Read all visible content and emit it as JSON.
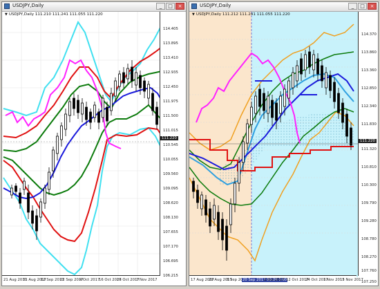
{
  "windows": [
    {
      "title": "USDJPY,Daily",
      "info_symbol": "USDJPY,Daily",
      "info_prices": "111.210 111.241 111.055 111.220",
      "controls": {
        "minimize": "_",
        "maximize": "□",
        "close": "×"
      },
      "y_ticks": [
        "114.405",
        "113.895",
        "113.410",
        "112.935",
        "112.450",
        "111.975",
        "111.500",
        "111.015",
        "110.545",
        "110.055",
        "109.560",
        "109.095",
        "108.620",
        "108.130",
        "107.655",
        "107.170",
        "106.695",
        "106.215"
      ],
      "price_tag": "111.220",
      "x_labels": [
        "21 Aug 2017",
        "31 Aug 2017",
        "12 Sep 2017",
        "22 Sep 2017",
        "4 Oct 2017",
        "16 Oct 2017",
        "26 Oct 2017",
        "7 Nov 2017",
        "17 Nov 2017"
      ],
      "colors": {
        "bollinger_outer": "#40e0f0",
        "bollinger_mid": "#e01010",
        "bollinger_inner": "#0a7a0a",
        "sma": "#1a1adc",
        "chikou": "#ff20ff",
        "candles": "#000000"
      }
    },
    {
      "title": "USDJPY,Daily",
      "info_symbol": "USDJPY,Daily",
      "info_prices": "111.212 111.241 111.055 111.220",
      "controls": {
        "minimize": "_",
        "maximize": "□",
        "close": "×"
      },
      "y_ticks": [
        "114.370",
        "113.860",
        "113.360",
        "112.850",
        "112.340",
        "111.830",
        "111.320",
        "110.810",
        "110.300",
        "109.790",
        "109.280",
        "108.780",
        "108.270",
        "107.760",
        "107.250"
      ],
      "price_tag": "111.220",
      "x_labels": [
        "17 Aug 2017",
        "29 Aug 2017",
        "8 Sep 2017",
        "20 Sep 2017 09:28 0:00",
        "2 Oct 2017",
        "12 Oct 2017",
        "24 Oct 2017",
        "3 Nov 2017",
        "15 Nov 2017"
      ],
      "highlight_label_index": 3,
      "colors": {
        "cloud_bg": "#c8f2fb",
        "left_bg": "#fbe6cc",
        "bollinger_outer": "#f0a020",
        "bollinger_inner": "#0a7a0a",
        "trend": "#e01010",
        "kijun": "#1a1adc",
        "tenkan": "#30a0e0",
        "chikou": "#ff20ff",
        "candles": "#000000"
      }
    }
  ]
}
